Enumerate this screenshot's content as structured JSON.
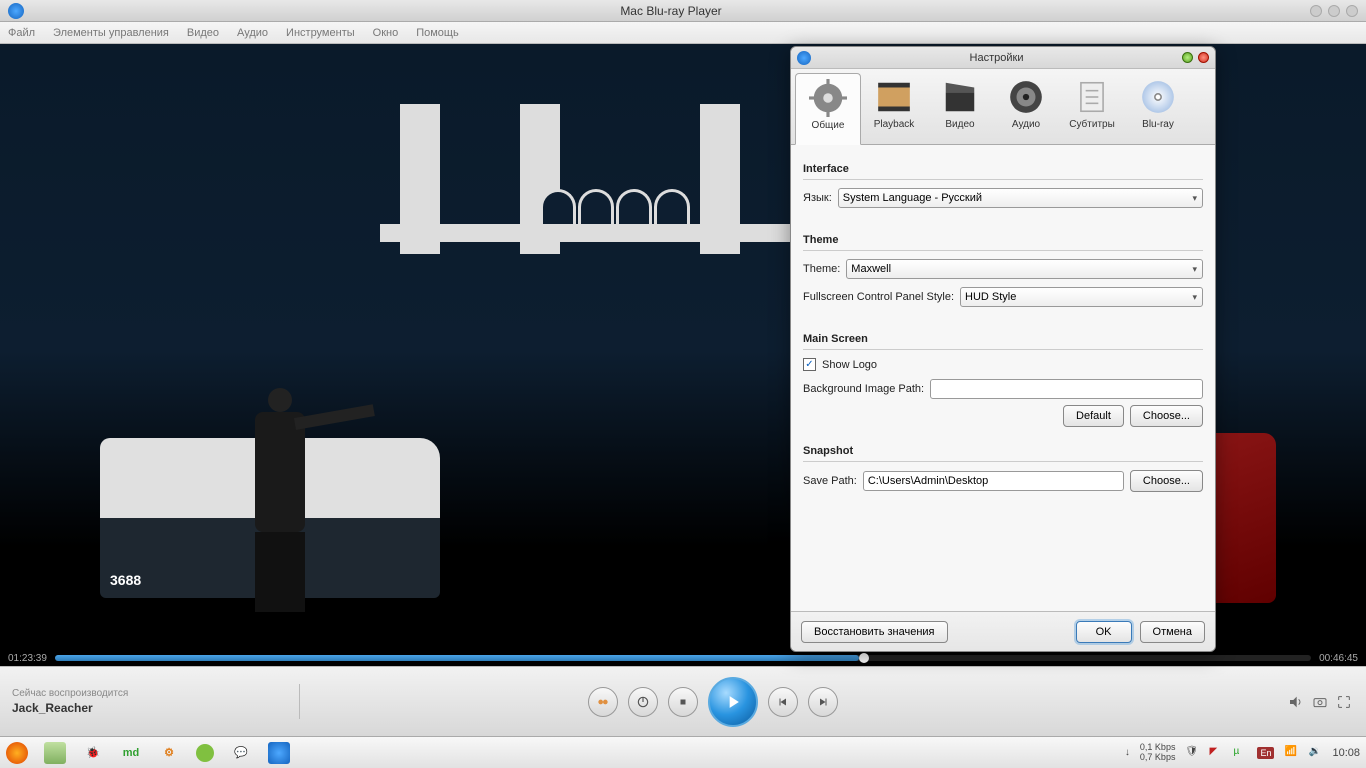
{
  "window": {
    "title": "Mac Blu-ray Player"
  },
  "menu": {
    "file": "Файл",
    "controls": "Элементы управления",
    "video": "Видео",
    "audio": "Аудио",
    "tools": "Инструменты",
    "window": "Окно",
    "help": "Помощь"
  },
  "playback": {
    "current": "01:23:39",
    "total": "00:46:45"
  },
  "now_playing": {
    "label": "Сейчас воспроизводится",
    "name": "Jack_Reacher"
  },
  "settings": {
    "title": "Настройки",
    "tabs": {
      "general": "Общие",
      "playback": "Playback",
      "video": "Видео",
      "audio": "Аудио",
      "subtitles": "Субтитры",
      "bluray": "Blu-ray"
    },
    "interface": {
      "heading": "Interface",
      "lang_label": "Язык:",
      "lang_value": "System Language - Русский"
    },
    "theme": {
      "heading": "Theme",
      "theme_label": "Theme:",
      "theme_value": "Maxwell",
      "fcps_label": "Fullscreen Control Panel Style:",
      "fcps_value": "HUD Style"
    },
    "main_screen": {
      "heading": "Main Screen",
      "show_logo": "Show Logo",
      "bg_label": "Background Image Path:",
      "bg_value": "",
      "default_btn": "Default",
      "choose_btn": "Choose..."
    },
    "snapshot": {
      "heading": "Snapshot",
      "path_label": "Save Path:",
      "path_value": "C:\\Users\\Admin\\Desktop",
      "choose_btn": "Choose..."
    },
    "footer": {
      "restore": "Восстановить значения",
      "ok": "OK",
      "cancel": "Отмена"
    }
  },
  "taskbar": {
    "clock": "10:08",
    "down": "0,1 Kbps",
    "up": "0,7 Kbps",
    "lang": "En"
  }
}
